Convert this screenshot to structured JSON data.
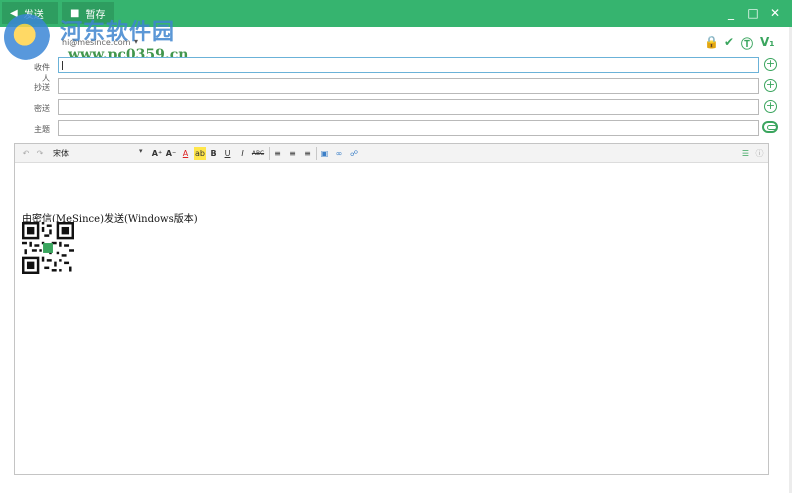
{
  "titlebar": {
    "send_label": "发送",
    "save_label": "暂存",
    "minimize": "_",
    "maximize": "□",
    "close": "✕"
  },
  "watermark": {
    "title": "河东软件园",
    "url": "www.pc0359.cn"
  },
  "account": {
    "email": "hi@mesince.com",
    "caret": "▾"
  },
  "right_tools": {
    "lock": "🔒",
    "verify": "✔",
    "timer": "Ⓣ",
    "version": "V₁"
  },
  "fields": {
    "to_label": "收件人",
    "cc_label": "抄送",
    "bcc_label": "密送",
    "subject_label": "主题",
    "to_value": "",
    "cc_value": "",
    "bcc_value": "",
    "subject_value": ""
  },
  "editor": {
    "font": "宋体",
    "font_caret": "▾",
    "tools": {
      "undo": "↶",
      "redo": "↷",
      "font_grow": "A⁺",
      "font_shrink": "A⁻",
      "font_color": "A",
      "highlight": "ab",
      "bold": "B",
      "underline": "U",
      "italic": "I",
      "strike": "ABC",
      "align_left": "≡",
      "align_center": "≡",
      "align_right": "≡",
      "image": "▣",
      "link": "∞",
      "find": "☍",
      "template": "☰",
      "info": "ⓘ"
    },
    "signature": "由密信(MeSince)发送(Windows版本)"
  },
  "colors": {
    "accent": "#36b46f",
    "icon_green": "#3aa55e"
  }
}
